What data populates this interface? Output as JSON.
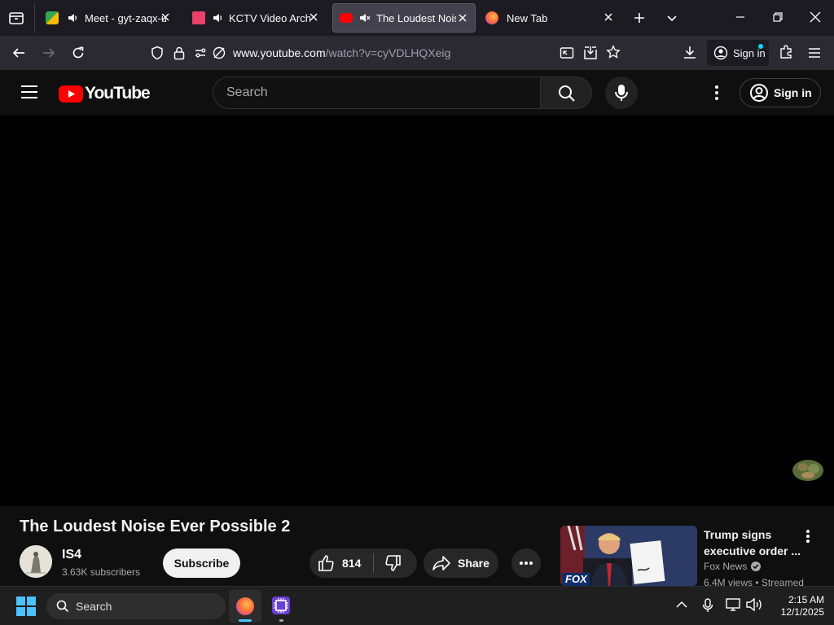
{
  "browser": {
    "tabs": [
      {
        "title": "Meet - gyt-zaqx-ufb",
        "favicon": "meet-icon"
      },
      {
        "title": "KCTV Video Archive",
        "favicon": "kctv-icon"
      },
      {
        "title": "The Loudest Noise",
        "favicon": "youtube-icon",
        "active": true
      },
      {
        "title": "New Tab",
        "favicon": "firefox-icon"
      }
    ],
    "url_domain": "www.youtube.com",
    "url_path": "/watch?v=cyVDLHQXeig",
    "signin_label": "Sign in"
  },
  "youtube": {
    "logo_text": "YouTube",
    "search_placeholder": "Search",
    "signin_label": "Sign in",
    "accent": "#ff0000"
  },
  "video": {
    "title": "The Loudest Noise Ever Possible 2",
    "channel": "IS4",
    "subscribers": "3.63K subscribers",
    "subscribe_label": "Subscribe",
    "likes": "814",
    "share_label": "Share"
  },
  "recommendation": {
    "title": "Trump signs executive order ...",
    "channel": "Fox News",
    "meta": "6.4M views • Streamed",
    "thumb_badge": "FOX"
  },
  "taskbar": {
    "search_label": "Search",
    "time": "2:15 AM",
    "date": "12/1/2025"
  }
}
